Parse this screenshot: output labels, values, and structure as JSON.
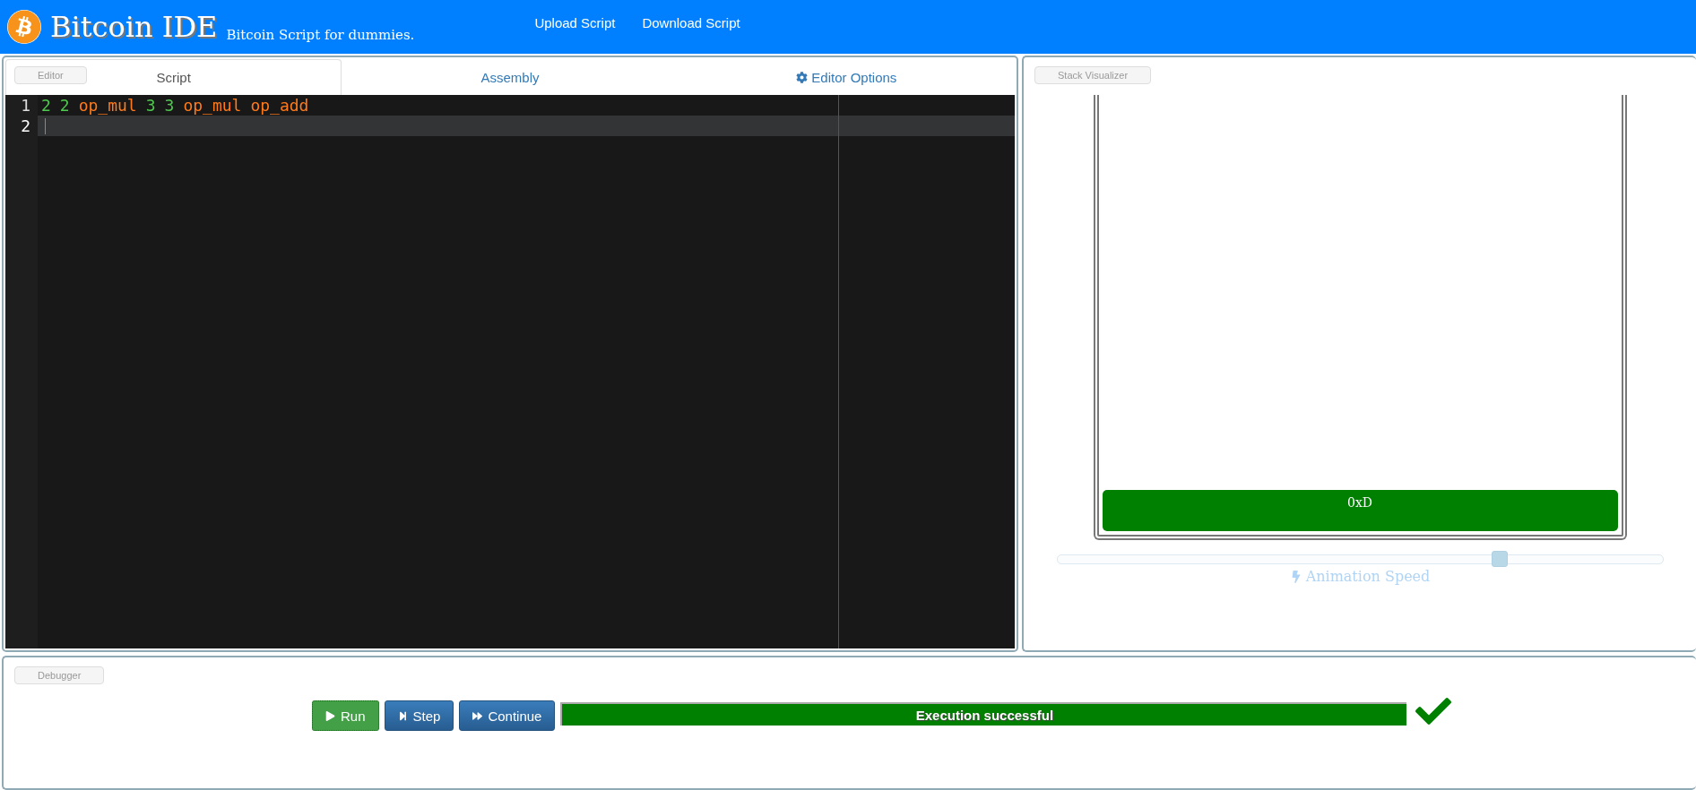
{
  "header": {
    "title": "Bitcoin IDE",
    "tagline": "Bitcoin Script for dummies.",
    "links": [
      "Upload Script",
      "Download Script"
    ]
  },
  "editor": {
    "label": "Editor",
    "tabs": [
      {
        "label": "Script",
        "selected": true
      },
      {
        "label": "Assembly",
        "selected": false
      },
      {
        "label": "Editor Options",
        "selected": false
      }
    ],
    "lines": [
      {
        "number": "1",
        "active": false,
        "tokens": [
          {
            "text": "2",
            "kind": "number"
          },
          {
            "text": "2",
            "kind": "number"
          },
          {
            "text": "op_mul",
            "kind": "opcode"
          },
          {
            "text": "3",
            "kind": "number"
          },
          {
            "text": "3",
            "kind": "number"
          },
          {
            "text": "op_mul",
            "kind": "opcode"
          },
          {
            "text": "op_add",
            "kind": "opcode"
          }
        ]
      },
      {
        "number": "2",
        "active": true
      }
    ]
  },
  "stack": {
    "label": "Stack Visualizer",
    "items": [
      "0xD"
    ],
    "speed": {
      "level": 0.73,
      "label": "Animation Speed"
    }
  },
  "debugger": {
    "label": "Debugger",
    "buttons": [
      {
        "label": "Run",
        "kind": "run"
      },
      {
        "label": "Step",
        "kind": "step"
      },
      {
        "label": "Continue",
        "kind": "continue"
      }
    ],
    "status": {
      "text": "Execution successful",
      "level": 1,
      "success": true
    }
  }
}
